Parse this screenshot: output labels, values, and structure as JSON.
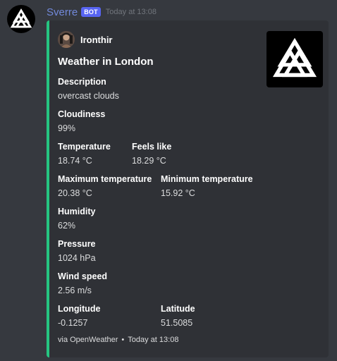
{
  "message": {
    "username": "Sverre",
    "badge": "BOT",
    "timestamp": "Today at 13:08"
  },
  "embed": {
    "accent_color": "#25c581",
    "author_name": "Ironthir",
    "title": "Weather in London",
    "fields": [
      {
        "name": "Description",
        "value": "overcast clouds"
      },
      {
        "name": "Cloudiness",
        "value": "99%"
      },
      {
        "name": "Temperature",
        "value": "18.74 °C"
      },
      {
        "name": "Feels like",
        "value": "18.29 °C"
      },
      {
        "name": "Maximum temperature",
        "value": "20.38 °C"
      },
      {
        "name": "Minimum temperature",
        "value": "15.92 °C"
      },
      {
        "name": "Humidity",
        "value": "62%"
      },
      {
        "name": "Pressure",
        "value": "1024 hPa"
      },
      {
        "name": "Wind speed",
        "value": "2.56 m/s"
      },
      {
        "name": "Longitude",
        "value": "-0.1257"
      },
      {
        "name": "Latitude",
        "value": "51.5085"
      }
    ],
    "footer_text": "via OpenWeather",
    "footer_separator": "•",
    "footer_timestamp": "Today at 13:08"
  },
  "icons": {
    "bot_avatar": "valknut-logo-icon",
    "author_avatar": "user-avatar-icon",
    "thumbnail": "valknut-logo-icon"
  }
}
